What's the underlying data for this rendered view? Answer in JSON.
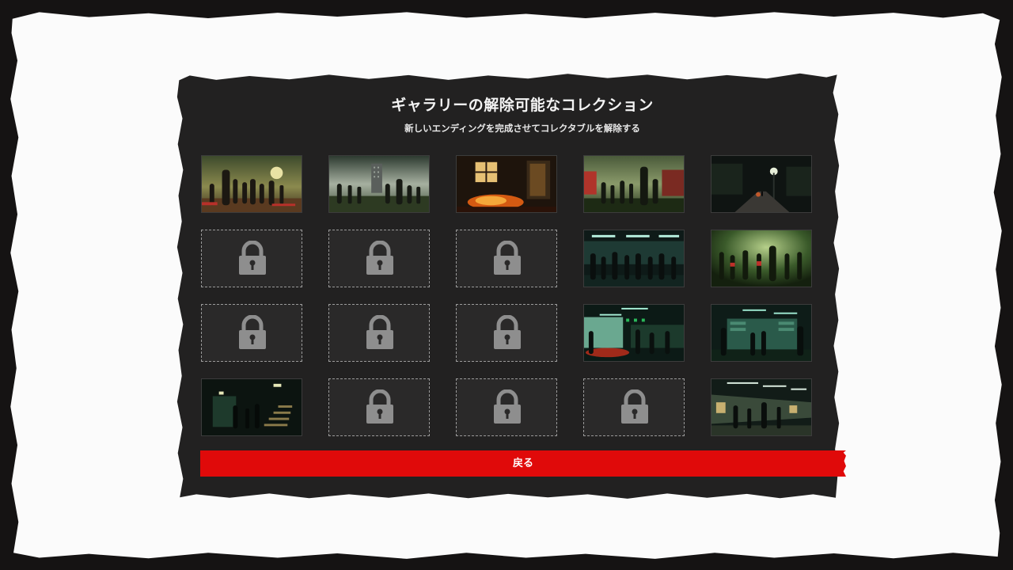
{
  "gallery": {
    "title": "ギャラリーの解除可能なコレクション",
    "subtitle": "新しいエンディングを完成させてコレクタブルを解除する",
    "tiles": [
      {
        "state": "unlocked",
        "scene": "zombie-horde-moon-field"
      },
      {
        "state": "unlocked",
        "scene": "zombie-horde-city-tower"
      },
      {
        "state": "unlocked",
        "scene": "burning-room-window"
      },
      {
        "state": "unlocked",
        "scene": "zombie-horde-red-houses"
      },
      {
        "state": "unlocked",
        "scene": "night-street-lamp"
      },
      {
        "state": "locked",
        "icon": "padlock-icon"
      },
      {
        "state": "locked",
        "icon": "padlock-icon"
      },
      {
        "state": "locked",
        "icon": "padlock-icon"
      },
      {
        "state": "unlocked",
        "scene": "zombies-subway-station"
      },
      {
        "state": "unlocked",
        "scene": "zombies-green-forest"
      },
      {
        "state": "locked",
        "icon": "padlock-icon"
      },
      {
        "state": "locked",
        "icon": "padlock-icon"
      },
      {
        "state": "locked",
        "icon": "padlock-icon"
      },
      {
        "state": "unlocked",
        "scene": "zombies-supermarket"
      },
      {
        "state": "unlocked",
        "scene": "zombies-store-aisle"
      },
      {
        "state": "unlocked",
        "scene": "dark-stairwell-lights"
      },
      {
        "state": "locked",
        "icon": "padlock-icon"
      },
      {
        "state": "locked",
        "icon": "padlock-icon"
      },
      {
        "state": "locked",
        "icon": "padlock-icon"
      },
      {
        "state": "unlocked",
        "scene": "zombies-mall-corridor"
      }
    ]
  },
  "back_button": {
    "label": "戻る"
  },
  "colors": {
    "background": "#151313",
    "paper": "#fbfbfb",
    "panel": "#222121",
    "button": "#e00a0a",
    "lock": "#8e8e8e"
  }
}
